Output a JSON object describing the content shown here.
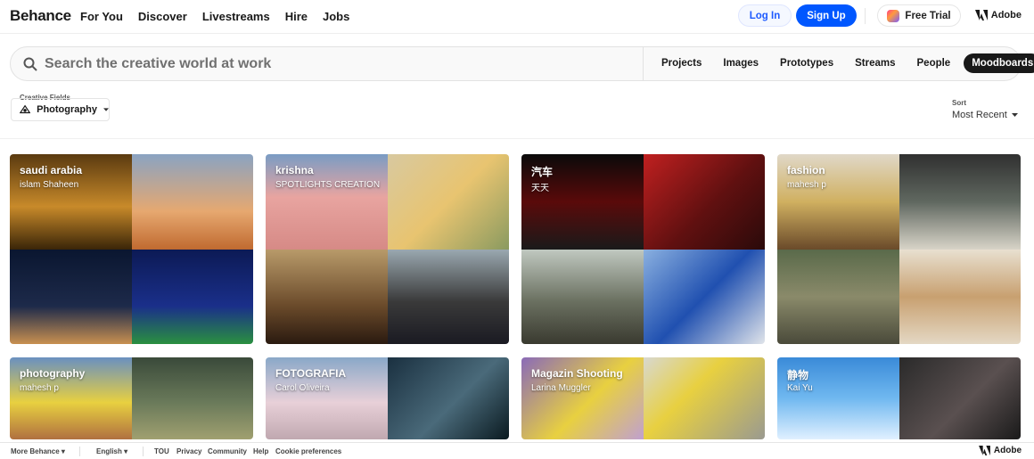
{
  "brand": "Behance",
  "nav": {
    "items": [
      "For You",
      "Discover",
      "Livestreams",
      "Hire",
      "Jobs"
    ]
  },
  "header": {
    "login": "Log In",
    "signup": "Sign Up",
    "free_trial": "Free Trial",
    "adobe": "Adobe"
  },
  "search": {
    "placeholder": "Search the creative world at work",
    "tabs": [
      "Projects",
      "Images",
      "Prototypes",
      "Streams",
      "People",
      "Moodboards"
    ],
    "active_tab": "Moodboards"
  },
  "filters": {
    "creative_fields_label": "Creative Fields",
    "creative_field": "Photography",
    "sort_label": "Sort",
    "sort_value": "Most Recent"
  },
  "moodboards": [
    {
      "title": "saudi arabia",
      "owner": "islam Shaheen"
    },
    {
      "title": "krishna",
      "owner": "SPOTLIGHTS CREATION"
    },
    {
      "title": "汽车",
      "owner": "天天"
    },
    {
      "title": "fashion",
      "owner": "mahesh p"
    },
    {
      "title": "photography",
      "owner": "mahesh p"
    },
    {
      "title": "FOTOGRAFIA",
      "owner": "Carol Oliveira"
    },
    {
      "title": "Magazin Shooting",
      "owner": "Larina Muggler"
    },
    {
      "title": "静物",
      "owner": "Kai Yu"
    }
  ],
  "footer": {
    "more": "More Behance",
    "language": "English",
    "links": [
      "TOU",
      "Privacy",
      "Community",
      "Help",
      "Cookie preferences"
    ],
    "adobe": "Adobe"
  },
  "colors": {
    "primary": "#0057ff",
    "active_tab_bg": "#191919"
  }
}
